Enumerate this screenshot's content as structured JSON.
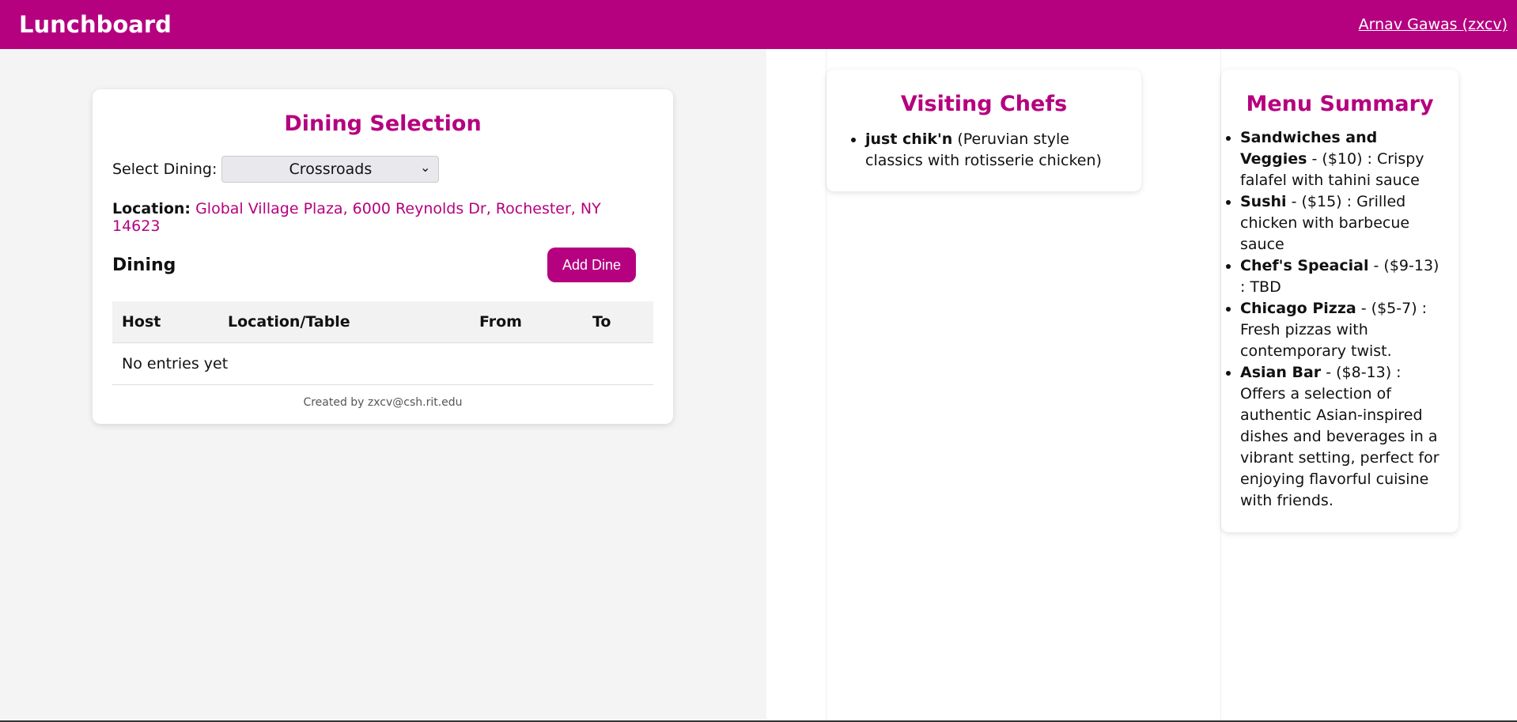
{
  "header": {
    "brand": "Lunchboard",
    "user": "Arnav Gawas (zxcv)"
  },
  "dining": {
    "title": "Dining Selection",
    "select_label": "Select Dining:",
    "selected": "Crossroads",
    "location_label": "Location:",
    "location": "Global Village Plaza, 6000 Reynolds Dr, Rochester, NY 14623",
    "section_label": "Dining",
    "add_button": "Add Dine",
    "columns": [
      "Host",
      "Location/Table",
      "From",
      "To"
    ],
    "empty": "No entries yet",
    "created_by": "Created by zxcv@csh.rit.edu"
  },
  "chefs": {
    "title": "Visiting Chefs",
    "items": [
      {
        "name": "just chik'n",
        "desc": " (Peruvian style classics with rotisserie chicken)"
      }
    ]
  },
  "menu": {
    "title": "Menu Summary",
    "items": [
      {
        "name": "Sandwiches and Veggies",
        "desc": " - ($10) : Crispy falafel with tahini sauce"
      },
      {
        "name": "Sushi",
        "desc": " - ($15) : Grilled chicken with barbecue sauce"
      },
      {
        "name": "Chef's Speacial",
        "desc": " - ($9-13) : TBD"
      },
      {
        "name": "Chicago Pizza",
        "desc": " - ($5-7) : Fresh pizzas with contemporary twist."
      },
      {
        "name": "Asian Bar",
        "desc": " - ($8-13) : Offers a selection of authentic Asian-inspired dishes and beverages in a vibrant setting, perfect for enjoying flavorful cuisine with friends."
      }
    ]
  },
  "colors": {
    "brand": "#b5017f",
    "background": "#f4f4f4"
  }
}
